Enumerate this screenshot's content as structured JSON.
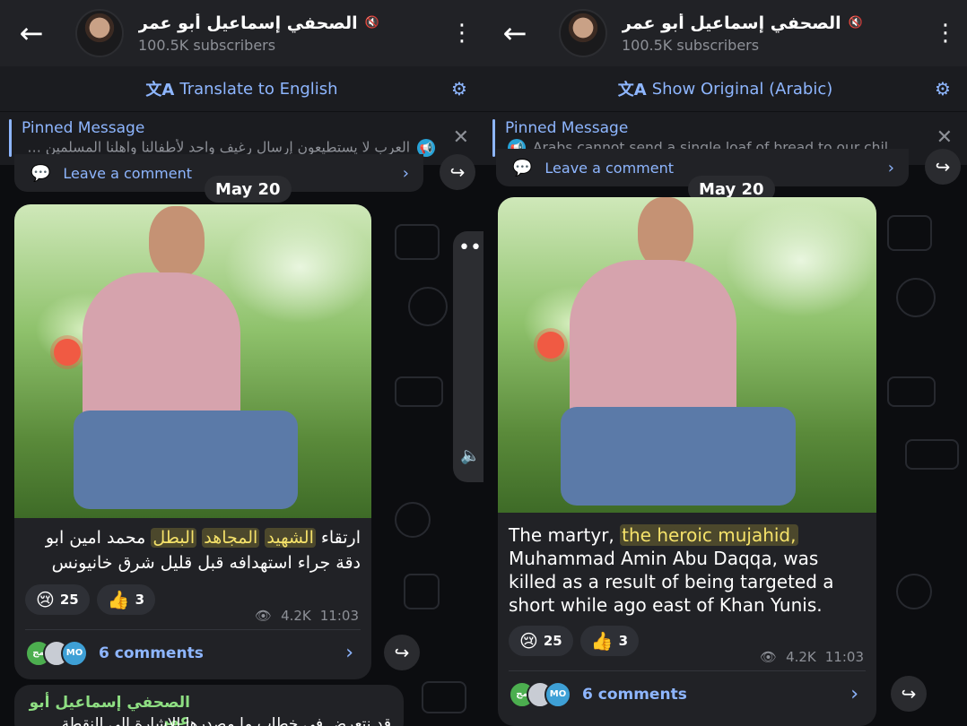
{
  "channel": {
    "title": "الصحفي إسماعيل أبو عمر",
    "subscribers": "100.5K subscribers"
  },
  "left": {
    "translate_label": "Translate to English",
    "pinned_title": "Pinned Message",
    "pinned_text": "العرب لا يستطيعون إرسال رغيف واحد لأطفالنا واهلنا المسلمين ب...",
    "prev_comment_label": "Leave a comment",
    "date": "May 20",
    "message_text_before": "ارتقاء ",
    "message_hl_1": "الشهيد",
    "message_hl_2": "المجاهد",
    "message_hl_3": "البطل",
    "message_text_after": " محمد امين ابو دقة جراء استهدافه قبل قليل شرق خانيونس",
    "reactions": [
      {
        "emoji": "😢",
        "count": "25"
      },
      {
        "emoji": "👍",
        "count": "3"
      }
    ],
    "views": "4.2K",
    "time": "11:03",
    "comments_label": "6 comments",
    "mini_avatars": [
      "مج",
      "",
      "MO"
    ],
    "next_sender": "الصحفي إسماعيل أبو عمر",
    "next_text": "قد نتعرض في خطاب ما مصدرها الإشارة إلى النقطة ..."
  },
  "right": {
    "translate_label": "Show Original (Arabic)",
    "pinned_title": "Pinned Message",
    "pinned_text": "Arabs cannot send a single loaf of bread to our chil...",
    "prev_comment_label": "Leave a comment",
    "date": "May 20",
    "message_text_before": "The martyr, ",
    "message_hl": "the heroic mujahid,",
    "message_text_after": " Muhammad Amin Abu Daqqa, was killed as a result of being targeted a short while ago east of Khan Yunis.",
    "reactions": [
      {
        "emoji": "😢",
        "count": "25"
      },
      {
        "emoji": "👍",
        "count": "3"
      }
    ],
    "views": "4.2K",
    "time": "11:03",
    "comments_label": "6 comments",
    "mini_avatars": [
      "مج",
      "",
      "MO"
    ]
  },
  "icons": {
    "back": "←",
    "kebab": "⋮",
    "mute": "🔇",
    "translate": "文A",
    "settings": "⚙",
    "close": "✕",
    "chevron": "›",
    "share": "↪",
    "eye": "👁",
    "comment": "💬",
    "volume": "🔈"
  },
  "colors": {
    "accent": "#8eb6ff",
    "header_bg": "#212226",
    "bubble_bg": "#212226",
    "highlight": "#f5e26a",
    "sender_name": "#8ede82"
  }
}
